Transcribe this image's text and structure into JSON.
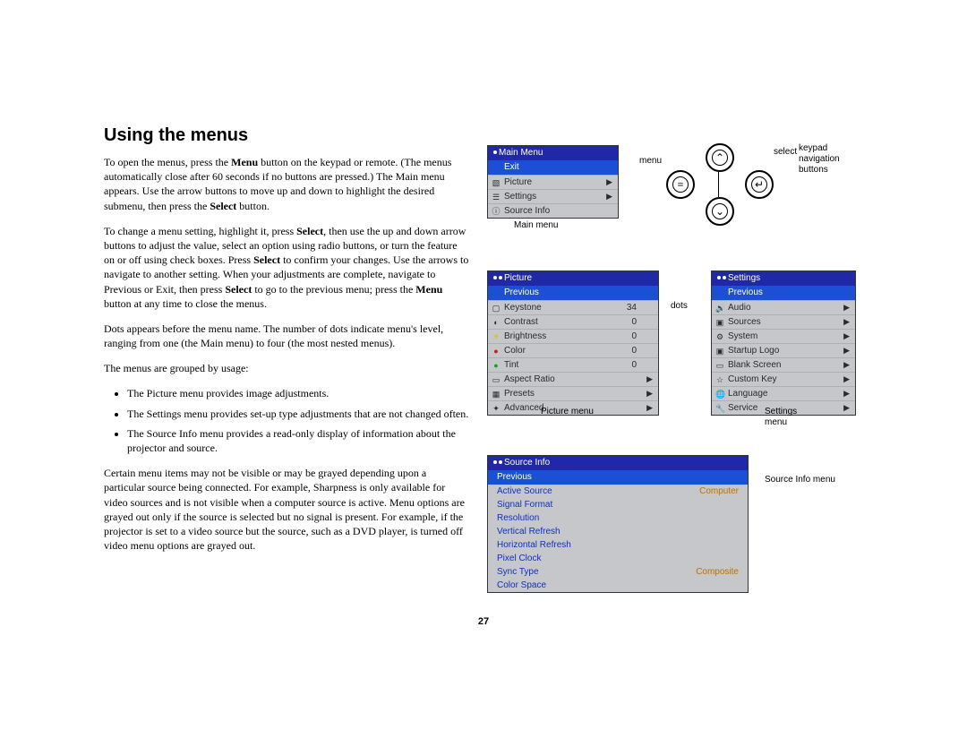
{
  "title": "Using the menus",
  "para1_pre": "To open the menus, press the ",
  "para1_b1": "Menu",
  "para1_mid": " button on the keypad or remote. (The menus automatically close after 60 seconds if no buttons are pressed.) The Main menu appears. Use the arrow buttons to move up and down to highlight the desired submenu, then press the ",
  "para1_b2": "Select",
  "para1_post": " button.",
  "para2_a": "To change a menu setting, highlight it, press ",
  "para2_b1": "Select",
  "para2_b": ", then use the up and down arrow buttons to adjust the value, select an option using radio buttons, or turn the feature on or off using check boxes. Press ",
  "para2_b2": "Select",
  "para2_c": " to confirm your changes. Use the arrows to navigate to another setting. When your adjustments are complete, navigate to Previous or Exit, then press ",
  "para2_b3": "Select",
  "para2_d": " to go to the previous menu; press the ",
  "para2_b4": "Menu",
  "para2_e": " button at any time to close the menus.",
  "para3": "Dots appears before the menu name. The number of dots indicate menu's level, ranging from one (the Main menu) to four (the most nested menus).",
  "para4": "The menus are grouped by usage:",
  "bullets": [
    "The Picture menu provides image adjustments.",
    "The Settings menu provides set-up type adjustments that are not changed often.",
    "The Source Info menu provides a read-only display of information about the projector and source."
  ],
  "para5": "Certain menu items may not be visible or may be grayed depending upon a particular source being connected. For example, Sharpness is only available for video sources and is not visible when a computer source is active. Menu options are grayed out only if the source is selected but no signal is present. For example, if the projector is set to a video source but the source, such as a DVD player, is turned off video menu options are grayed out.",
  "page_number": "27",
  "main_menu": {
    "header": "Main Menu",
    "highlight": "Exit",
    "rows": [
      {
        "label": "Picture",
        "arrow": "▶"
      },
      {
        "label": "Settings",
        "arrow": "▶"
      },
      {
        "label": "Source Info",
        "arrow": ""
      }
    ]
  },
  "picture_menu": {
    "header": "Picture",
    "highlight": "Previous",
    "rows": [
      {
        "label": "Keystone",
        "value": "34",
        "arrow": ""
      },
      {
        "label": "Contrast",
        "value": "0",
        "arrow": ""
      },
      {
        "label": "Brightness",
        "value": "0",
        "arrow": ""
      },
      {
        "label": "Color",
        "value": "0",
        "arrow": ""
      },
      {
        "label": "Tint",
        "value": "0",
        "arrow": ""
      },
      {
        "label": "Aspect Ratio",
        "value": "",
        "arrow": "▶"
      },
      {
        "label": "Presets",
        "value": "",
        "arrow": "▶"
      },
      {
        "label": "Advanced",
        "value": "",
        "arrow": "▶"
      }
    ]
  },
  "settings_menu": {
    "header": "Settings",
    "highlight": "Previous",
    "rows": [
      {
        "label": "Audio",
        "arrow": "▶"
      },
      {
        "label": "Sources",
        "arrow": "▶"
      },
      {
        "label": "System",
        "arrow": "▶"
      },
      {
        "label": "Startup Logo",
        "arrow": "▶"
      },
      {
        "label": "Blank Screen",
        "arrow": "▶"
      },
      {
        "label": "Custom Key",
        "arrow": "▶"
      },
      {
        "label": "Language",
        "arrow": "▶"
      },
      {
        "label": "Service",
        "arrow": "▶"
      }
    ]
  },
  "sourceinfo_menu": {
    "header": "Source Info",
    "highlight": "Previous",
    "rows": [
      {
        "label": "Active Source",
        "value": "Computer"
      },
      {
        "label": "Signal Format",
        "value": ""
      },
      {
        "label": "Resolution",
        "value": ""
      },
      {
        "label": "Vertical Refresh",
        "value": ""
      },
      {
        "label": "Horizontal Refresh",
        "value": ""
      },
      {
        "label": "Pixel Clock",
        "value": ""
      },
      {
        "label": "Sync Type",
        "value": "Composite"
      },
      {
        "label": "Color Space",
        "value": ""
      }
    ]
  },
  "captions": {
    "main_menu": "Main menu",
    "menu": "menu",
    "select": "select",
    "keypad": "keypad navigation buttons",
    "dots": "dots",
    "picture": "Picture menu",
    "settings": "Settings menu",
    "sourceinfo": "Source Info menu"
  }
}
